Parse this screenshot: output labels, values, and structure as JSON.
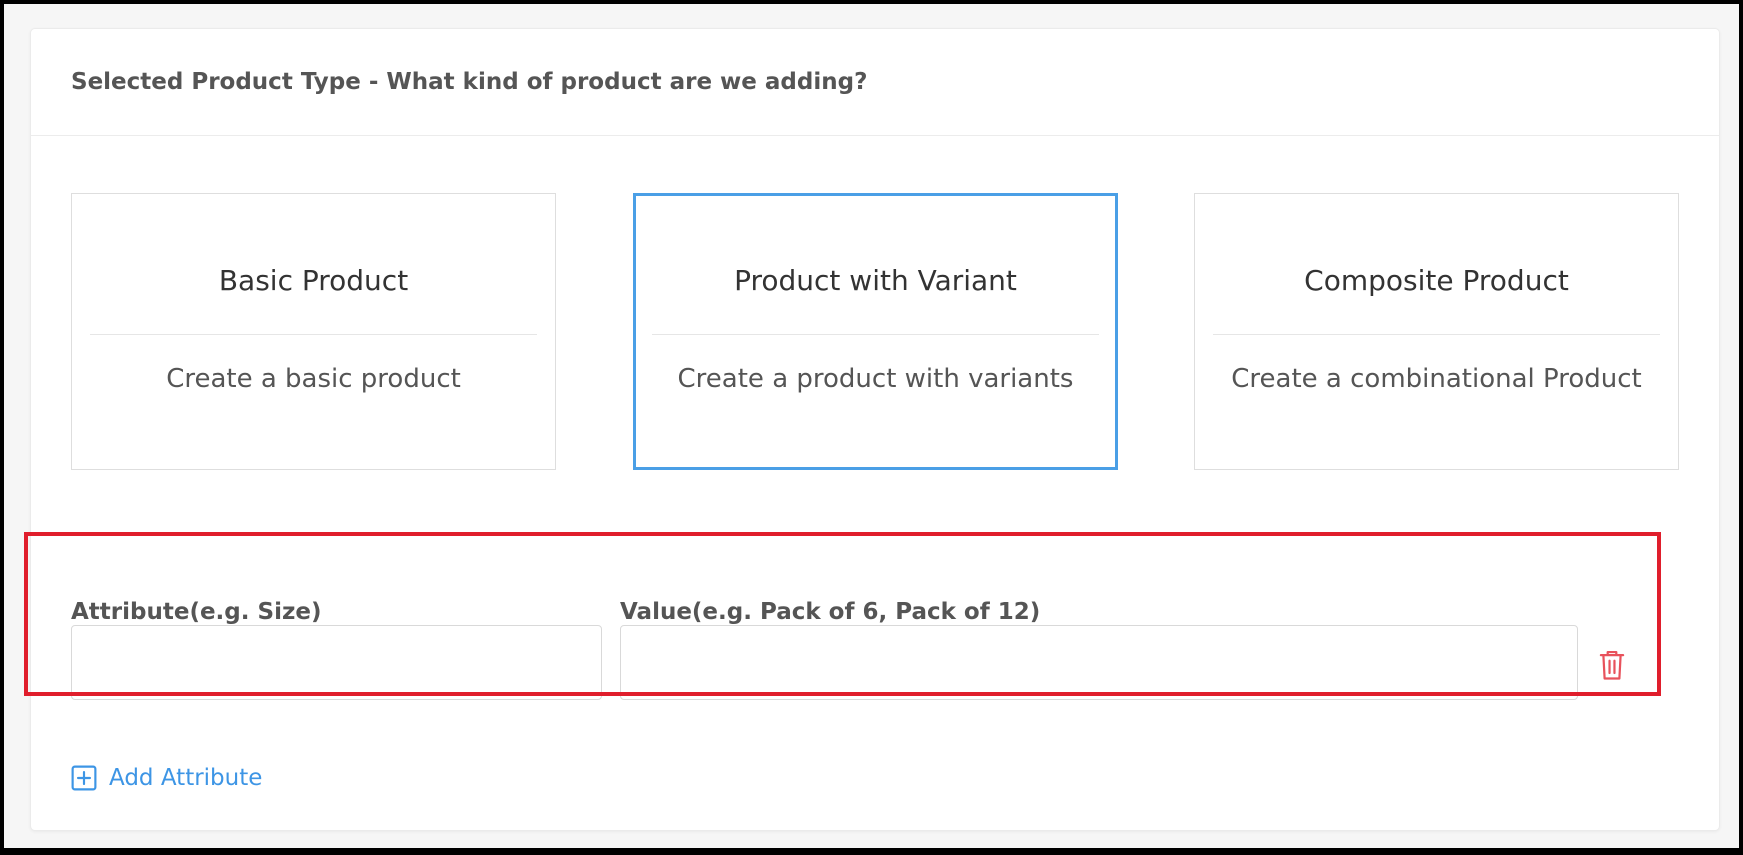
{
  "header": {
    "title": "Selected Product Type - What kind of product are we adding?"
  },
  "product_types": [
    {
      "title": "Basic Product",
      "description": "Create a basic product",
      "selected": false
    },
    {
      "title": "Product with Variant",
      "description": "Create a product with variants",
      "selected": true
    },
    {
      "title": "Composite Product",
      "description": "Create a combinational Product",
      "selected": false
    }
  ],
  "attribute_row": {
    "attribute_label": "Attribute(e.g. Size)",
    "attribute_value": "",
    "attribute_placeholder": "",
    "value_label": "Value(e.g. Pack of 6, Pack of 12)",
    "value_value": "",
    "value_placeholder": "",
    "delete_icon": "trash-icon"
  },
  "add_attribute": {
    "label": "Add Attribute",
    "icon": "plus-square-icon"
  },
  "colors": {
    "selected_border": "#4a9fe6",
    "highlight_border": "#e01e2c",
    "link": "#3d95e5",
    "delete": "#e8525c"
  }
}
